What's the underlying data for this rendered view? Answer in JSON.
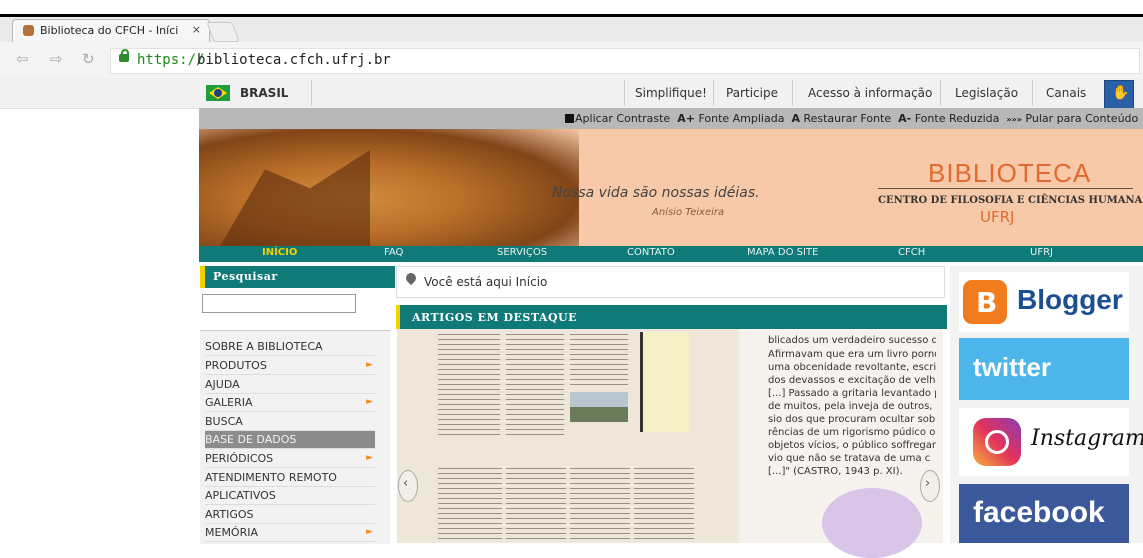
{
  "browser": {
    "tab_title": "Biblioteca do CFCH - Iníci",
    "tab_close": "×",
    "url_scheme": "https://",
    "url_host": "biblioteca.cfch.ufrj.br"
  },
  "gov_bar": {
    "country": "BRASIL",
    "links": [
      "Simplifique!",
      "Participe",
      "Acesso à informação",
      "Legislação",
      "Canais"
    ]
  },
  "accessibility": {
    "contrast_glyph": "",
    "contrast": "Aplicar Contraste",
    "larger_glyph": "A+",
    "larger": "Fonte Ampliada",
    "restore_glyph": "A",
    "restore": "Restaurar Fonte",
    "smaller_glyph": "A-",
    "smaller": "Fonte Reduzida",
    "skip_glyph": "»»»",
    "skip": "Pular para Conteúdo"
  },
  "banner": {
    "motto": "Nossa vida são nossas idéias.",
    "motto_author": "Anísio Teixeira",
    "title": "BIBLIOTECA",
    "subtitle": "CENTRO DE FILOSOFIA E CIÊNCIAS HUMANAS",
    "institution": "UFRJ"
  },
  "main_nav": {
    "items": [
      "INÍCIO",
      "FAQ",
      "SERVIÇOS",
      "CONTATO",
      "MAPA DO SITE",
      "CFCH",
      "UFRJ"
    ]
  },
  "sidebar": {
    "search_title": "Pesquisar",
    "items": [
      {
        "label": "SOBRE A BIBLIOTECA"
      },
      {
        "label": "PRODUTOS"
      },
      {
        "label": "AJUDA"
      },
      {
        "label": "GALERIA"
      },
      {
        "label": "BUSCA"
      },
      {
        "label": "BASE DE DADOS"
      },
      {
        "label": "PERIÓDICOS"
      },
      {
        "label": "ATENDIMENTO REMOTO"
      },
      {
        "label": "APLICATIVOS"
      },
      {
        "label": "ARTIGOS"
      },
      {
        "label": "MEMÓRIA"
      }
    ]
  },
  "breadcrumb": {
    "text": "Você está aqui   Início"
  },
  "articles": {
    "title": "Artigos em destaque",
    "right_text": [
      "blicados um verdadeiro sucesso de",
      "Afirmavam que era um livro porno",
      "uma obcenidade revoltante, escrito p",
      "dos devassos e excitação de velhos",
      "[...] Passado a gritaria levantado pelo",
      "de muitos, pela inveja de outros, e pe",
      "sio dos que procuram ocultar sobre as",
      "rências de um rigorismo púdico os m",
      "objetos vícios, o público soffregament",
      "vio que não se tratava de uma c",
      "[...]\" (CASTRO, 1943 p. XI)."
    ]
  },
  "social": {
    "blogger": "Blogger",
    "twitter": "twitter",
    "instagram": "Instagram",
    "facebook": "facebook"
  }
}
